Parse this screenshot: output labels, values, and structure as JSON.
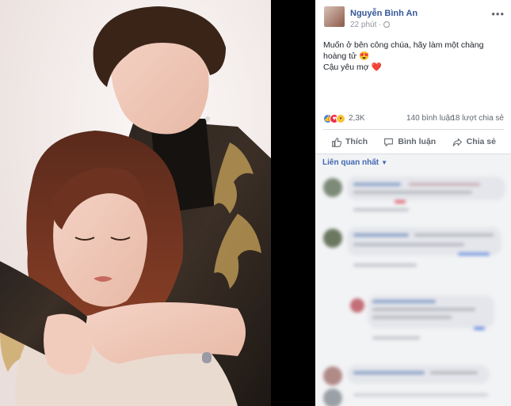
{
  "post": {
    "author": "Nguyễn Bình An",
    "timestamp": "22 phút",
    "text_line1": "Muốn ở bên công chúa, hãy làm một chàng hoàng tử",
    "text_emoji1": "😍",
    "text_line2": "Cậu yêu mợ",
    "text_emoji2": "❤️"
  },
  "stats": {
    "reactions_count": "2,3K",
    "comments": "140 bình luận",
    "shares": "18 lượt chia sẻ"
  },
  "actions": {
    "like": "Thích",
    "comment": "Bình luận",
    "share": "Chia sẻ"
  },
  "comments_header": {
    "sort_label": "Liên quan nhất"
  },
  "colors": {
    "link": "#365899",
    "accent": "#4267b2",
    "like_blue": "#3b7ff2",
    "love_red": "#f0284a",
    "wow_yellow": "#f7c33b"
  },
  "icons": {
    "more": "more-icon",
    "like": "thumbs-up-icon",
    "comment": "comment-icon",
    "share": "share-arrow-icon"
  }
}
